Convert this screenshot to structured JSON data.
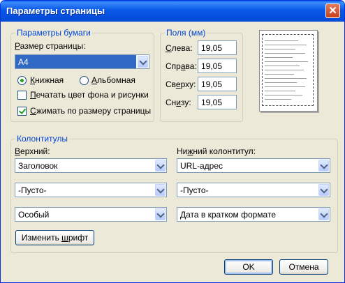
{
  "window": {
    "title": "Параметры страницы",
    "close_glyph": "✕"
  },
  "paper": {
    "group_label": "Параметры бумаги",
    "size_label_pre": "",
    "size_label_hot": "Р",
    "size_label_post": "азмер страницы:",
    "size_value": "A4",
    "portrait_pre": "",
    "portrait_hot": "К",
    "portrait_post": "нижная",
    "portrait_checked": true,
    "landscape_pre": "",
    "landscape_hot": "А",
    "landscape_post": "льбомная",
    "landscape_checked": false,
    "print_bg_pre": "",
    "print_bg_hot": "П",
    "print_bg_post": "ечатать цвет фона и рисунки",
    "print_bg_checked": false,
    "shrink_pre": "",
    "shrink_hot": "С",
    "shrink_post": "жимать по размеру страницы",
    "shrink_checked": true
  },
  "margins": {
    "group_label": "Поля (мм)",
    "left_pre": "",
    "left_hot": "С",
    "left_post": "лева:",
    "left_value": "19,05",
    "right_pre": "Спр",
    "right_hot": "а",
    "right_post": "ва:",
    "right_value": "19,05",
    "top_pre": "Св",
    "top_hot": "е",
    "top_post": "рху:",
    "top_value": "19,05",
    "bottom_pre": "Сн",
    "bottom_hot": "и",
    "bottom_post": "зу:",
    "bottom_value": "19,05"
  },
  "headers": {
    "group_label": "Колонтитулы",
    "header_label_pre": "",
    "header_label_hot": "В",
    "header_label_post": "ерхний:",
    "footer_label_pre": "Ни",
    "footer_label_hot": "ж",
    "footer_label_post": "ний колонтитул:",
    "header1": "Заголовок",
    "header2": "-Пусто-",
    "header3": "Особый",
    "footer1": "URL-адрес",
    "footer2": "-Пусто-",
    "footer3": "Дата в кратком формате",
    "font_btn_pre": "Изменить ",
    "font_btn_hot": "ш",
    "font_btn_post": "рифт"
  },
  "buttons": {
    "ok": "OK",
    "cancel": "Отмена"
  },
  "icons": {
    "dropdown": "chevron-down-icon",
    "close": "close-icon"
  },
  "colors": {
    "title_bar": "#0a58e8",
    "group_label": "#0046d5",
    "selection": "#316ac5",
    "dialog_bg": "#ece9d8"
  }
}
